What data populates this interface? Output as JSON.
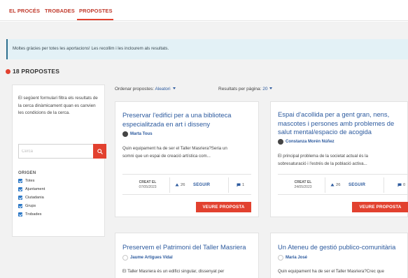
{
  "tabs": [
    {
      "label": "EL PROCÉS"
    },
    {
      "label": "TROBADES"
    },
    {
      "label": "PROPOSTES"
    }
  ],
  "notice": "Moltes gràcies per totes les aportacions! Les recollim i les inclourem als resultats.",
  "count": "18 PROPOSTES",
  "sidebar": {
    "description": "El següent formulari filtra els resultats de la cerca dinàmicament quan es canvien les condicions de la cerca.",
    "search_placeholder": "Cerca",
    "filter_title": "ORIGEN",
    "filters": [
      {
        "label": "Totes",
        "checked": true
      },
      {
        "label": "Ajuntament",
        "checked": true
      },
      {
        "label": "Ciutadania",
        "checked": true
      },
      {
        "label": "Grups",
        "checked": true
      },
      {
        "label": "Trobades",
        "checked": true
      }
    ]
  },
  "controls": {
    "order_label": "Ordenar propostes:",
    "order_value": "Aleatori",
    "per_page_label": "Resultats per pàgina:",
    "per_page_value": "20"
  },
  "cards": [
    {
      "title_1": "Preservar l'edifici per a una biblioteca",
      "title_2": "especialitzada en art i disseny",
      "author": "Marta Tous",
      "summary_1": "Quin equipament ha de ser el Taller Masriera?Seria un",
      "summary_2": "somni que un espai de creació artística com...",
      "created_label": "CREAT EL",
      "created_date": "07/05/2023",
      "votes": "26",
      "follow": "SEGUIR",
      "comments": "1",
      "button": "VEURE PROPOSTA"
    },
    {
      "title_1": "Espai d'acollida per a gent gran, nens,",
      "title_2": "mascotes i persones amb problemes de",
      "title_3": "salut mental/espacio de acogida",
      "author": "Constanza Morén Núñez",
      "summary_1": "El principal problema de la societat actual és la",
      "summary_2": "sobresaturació i l'estrés de la població activa...",
      "created_label": "CREAT EL",
      "created_date": "24/05/2023",
      "votes": "26",
      "follow": "SEGUIR",
      "comments": "0",
      "button": "VEURE PROPOSTA"
    },
    {
      "title_1": "Preservem el Patrimoni del Taller Masriera",
      "author": "Jaume Artigues Vidal",
      "summary_1": "El Taller Masriera és un edifici singular, dissenyat per"
    },
    {
      "title_1": "Un Ateneu de gestió publico-comunitària",
      "author": "Maria José",
      "summary_1": "Quin equipament ha de ser el Taller Masriera?Crec que"
    }
  ],
  "colors": {
    "accent": "#e2412f",
    "link": "#2c5a9e",
    "checkbox": "#2c78c6",
    "notice_bg": "#e3f1f6"
  }
}
